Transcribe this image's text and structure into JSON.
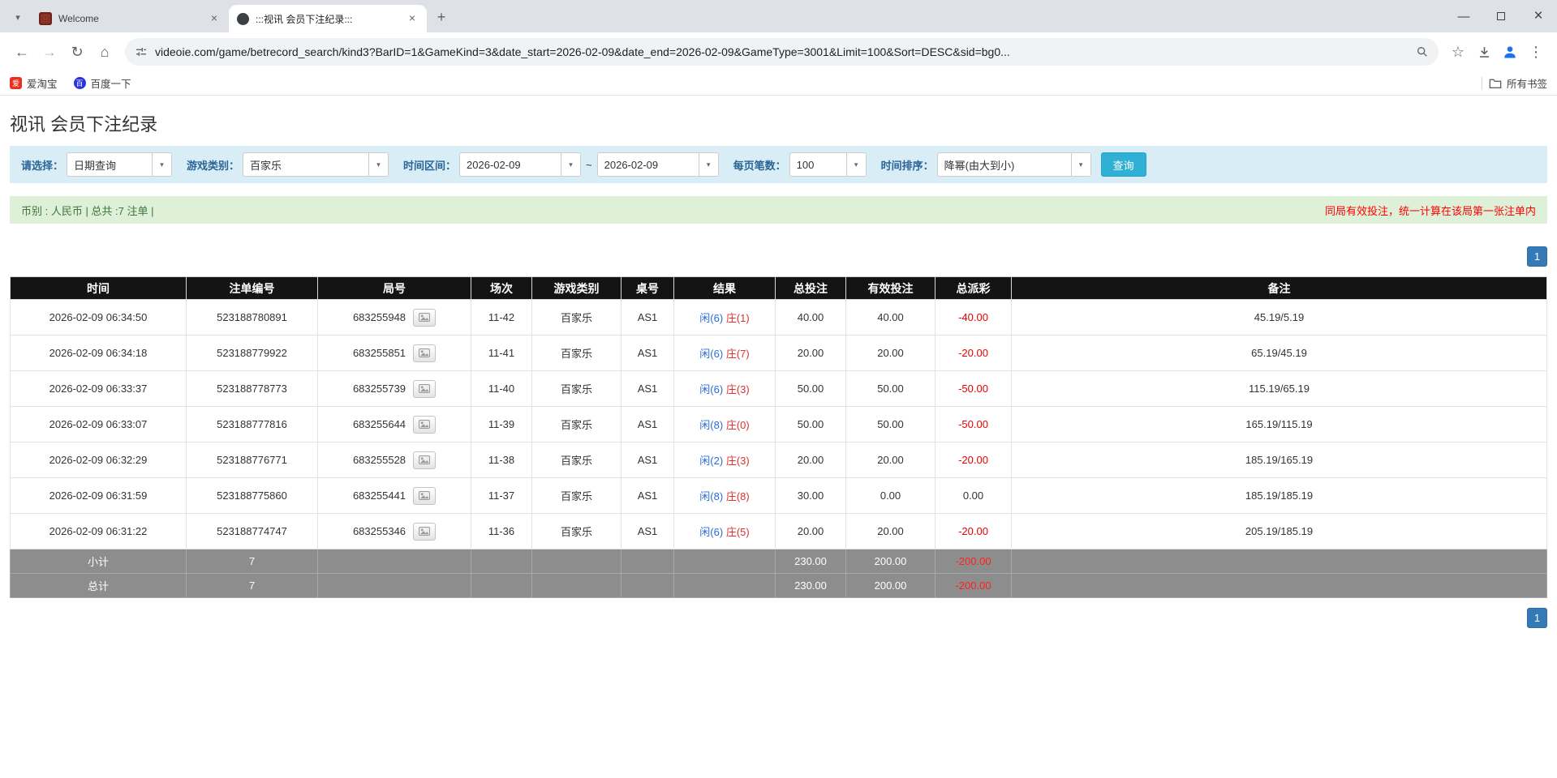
{
  "icons": {
    "chevron_down": "▾",
    "back": "←",
    "forward": "→",
    "reload": "↻",
    "home": "⌂",
    "new_tab": "+",
    "close": "×",
    "minimize": "—",
    "star": "☆",
    "menu": "⋮"
  },
  "colors": {
    "accent_blue": "#337ab7",
    "negative_red": "#e60000",
    "query_button": "#31b0d5",
    "filter_bar_bg": "#d9edf7",
    "summary_bar_bg": "#dff0d8",
    "table_header_bg": "#141414",
    "footer_row_bg": "#8d8d8d"
  },
  "browser": {
    "tabs": [
      {
        "title": "Welcome"
      },
      {
        "title": ":::视讯 会员下注纪录:::"
      }
    ],
    "url": "videoie.com/game/betrecord_search/kind3?BarID=1&GameKind=3&date_start=2026-02-09&date_end=2026-02-09&GameType=3001&Limit=100&Sort=DESC&sid=bg0...",
    "bookmarks": [
      {
        "label": "爱淘宝",
        "favicon_text": "爱",
        "favicon_color": "#e8301f"
      },
      {
        "label": "百度一下",
        "favicon_text": "百",
        "favicon_color": "#2932e1"
      }
    ],
    "all_bookmarks_label": "所有书签"
  },
  "page": {
    "title": "视讯 会员下注纪录",
    "filters": {
      "select_label": "请选择：",
      "select_value": "日期查询",
      "game_label": "游戏类别：",
      "game_value": "百家乐",
      "range_label": "时间区间：",
      "date_start": "2026-02-09",
      "range_separator": "~",
      "date_end": "2026-02-09",
      "per_page_label": "每页笔数：",
      "per_page_value": "100",
      "sort_label": "时间排序：",
      "sort_value": "降幂(由大到小)",
      "search_button": "查询"
    },
    "summary": {
      "left": "币别 : 人民币 | 总共 :7 注单 |",
      "right": "同局有效投注，统一计算在该局第一张注单内"
    },
    "pagination": "1",
    "table": {
      "headers": [
        "时间",
        "注单编号",
        "局号",
        "场次",
        "游戏类别",
        "桌号",
        "结果",
        "总投注",
        "有效投注",
        "总派彩",
        "备注"
      ],
      "rows": [
        {
          "time": "2026-02-09 06:34:50",
          "bet_id": "523188780891",
          "round": "683255948",
          "session": "11-42",
          "game": "百家乐",
          "table_no": "AS1",
          "result_player": "闲(6)",
          "result_banker": "庄(1)",
          "total_bet": "40.00",
          "valid_bet": "40.00",
          "payout": "-40.00",
          "note": "45.19/5.19"
        },
        {
          "time": "2026-02-09 06:34:18",
          "bet_id": "523188779922",
          "round": "683255851",
          "session": "11-41",
          "game": "百家乐",
          "table_no": "AS1",
          "result_player": "闲(6)",
          "result_banker": "庄(7)",
          "total_bet": "20.00",
          "valid_bet": "20.00",
          "payout": "-20.00",
          "note": "65.19/45.19"
        },
        {
          "time": "2026-02-09 06:33:37",
          "bet_id": "523188778773",
          "round": "683255739",
          "session": "11-40",
          "game": "百家乐",
          "table_no": "AS1",
          "result_player": "闲(6)",
          "result_banker": "庄(3)",
          "total_bet": "50.00",
          "valid_bet": "50.00",
          "payout": "-50.00",
          "note": "115.19/65.19"
        },
        {
          "time": "2026-02-09 06:33:07",
          "bet_id": "523188777816",
          "round": "683255644",
          "session": "11-39",
          "game": "百家乐",
          "table_no": "AS1",
          "result_player": "闲(8)",
          "result_banker": "庄(0)",
          "total_bet": "50.00",
          "valid_bet": "50.00",
          "payout": "-50.00",
          "note": "165.19/115.19"
        },
        {
          "time": "2026-02-09 06:32:29",
          "bet_id": "523188776771",
          "round": "683255528",
          "session": "11-38",
          "game": "百家乐",
          "table_no": "AS1",
          "result_player": "闲(2)",
          "result_banker": "庄(3)",
          "total_bet": "20.00",
          "valid_bet": "20.00",
          "payout": "-20.00",
          "note": "185.19/165.19"
        },
        {
          "time": "2026-02-09 06:31:59",
          "bet_id": "523188775860",
          "round": "683255441",
          "session": "11-37",
          "game": "百家乐",
          "table_no": "AS1",
          "result_player": "闲(8)",
          "result_banker": "庄(8)",
          "total_bet": "30.00",
          "valid_bet": "0.00",
          "payout": "0.00",
          "note": "185.19/185.19"
        },
        {
          "time": "2026-02-09 06:31:22",
          "bet_id": "523188774747",
          "round": "683255346",
          "session": "11-36",
          "game": "百家乐",
          "table_no": "AS1",
          "result_player": "闲(6)",
          "result_banker": "庄(5)",
          "total_bet": "20.00",
          "valid_bet": "20.00",
          "payout": "-20.00",
          "note": "205.19/185.19"
        }
      ],
      "subtotal": {
        "label": "小计",
        "count": "7",
        "total_bet": "230.00",
        "valid_bet": "200.00",
        "payout": "-200.00"
      },
      "total": {
        "label": "总计",
        "count": "7",
        "total_bet": "230.00",
        "valid_bet": "200.00",
        "payout": "-200.00"
      }
    }
  }
}
